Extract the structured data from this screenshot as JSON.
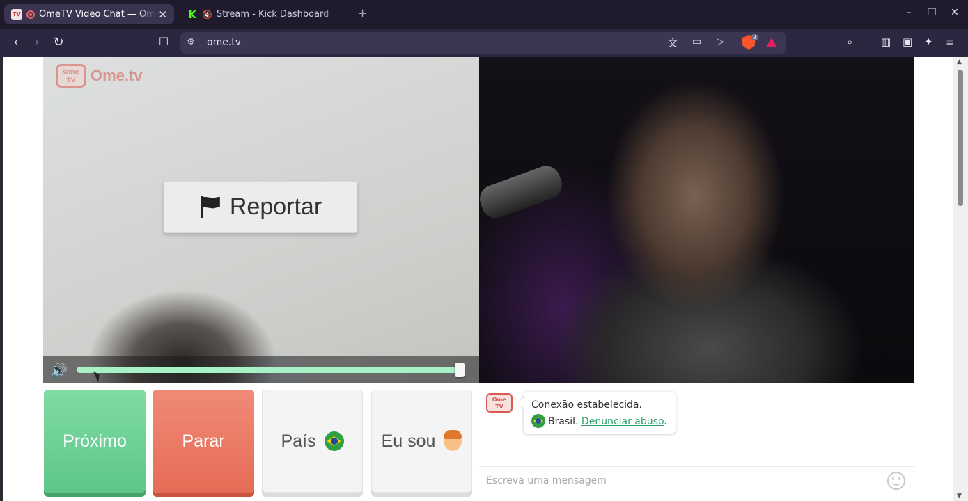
{
  "browser": {
    "tabs": [
      {
        "title": "OmeTV Video Chat — Ome",
        "active": true
      },
      {
        "title": "Stream - Kick Dashboard",
        "active": false
      }
    ],
    "url": "ome.tv",
    "shield_count": "2"
  },
  "app": {
    "logo_text": "Ome.tv",
    "logo_badge": "Ome TV",
    "report_label": "Reportar",
    "volume_level": 0.99,
    "buttons": {
      "next": "Próximo",
      "stop": "Parar",
      "country": "País",
      "gender": "Eu sou"
    },
    "chat": {
      "logo_badge": "Ome TV",
      "status": "Conexão estabelecida.",
      "country": "Brasil.",
      "report_link": "Denunciar abuso",
      "input_placeholder": "Escreva uma mensagem"
    }
  },
  "colors": {
    "next": "#6fd196",
    "stop": "#ea7a64",
    "accent": "#2aa36a",
    "brand": "#d75b50"
  },
  "icons": {
    "report": "flag-icon",
    "volume": "speaker-icon",
    "country": "brazil-flag-icon",
    "gender": "boy-icon",
    "emoji": "smiley-icon"
  }
}
